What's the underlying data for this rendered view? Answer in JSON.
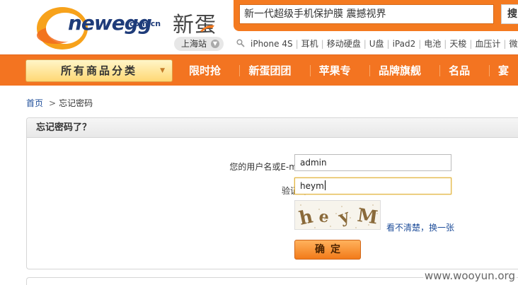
{
  "header": {
    "logo_text": "newegg",
    "logo_domain": "com.cn",
    "logo_cn": "新蛋",
    "region": "上海站",
    "search": {
      "value": "新一代超级手机保护膜 震撼视界",
      "button_label": "搜"
    },
    "hotwords": [
      "iPhone 4S",
      "耳机",
      "移动硬盘",
      "U盘",
      "iPad2",
      "电池",
      "天梭",
      "血压计",
      "微波"
    ]
  },
  "nav": {
    "category_button": "所有商品分类",
    "items": [
      "限时抢购",
      "新蛋团团赚",
      "苹果专区",
      "品牌旗舰店",
      "名品汇",
      "宴"
    ]
  },
  "breadcrumb": {
    "home": "首页",
    "separator": ">",
    "current": "忘记密码"
  },
  "form": {
    "title": "忘记密码了？",
    "username_label": "您的用户名或E-mail:",
    "username_value": "admin",
    "captcha_label": "验证码:",
    "captcha_value": "heym",
    "captcha_image_text": "heym",
    "refresh_link": "看不清楚，换一张",
    "submit_label": "确定"
  },
  "watermark": "www.wooyun.org",
  "colors": {
    "brand_orange": "#f37421",
    "link_blue": "#1f4e9a",
    "logo_blue": "#1f3c7a"
  }
}
